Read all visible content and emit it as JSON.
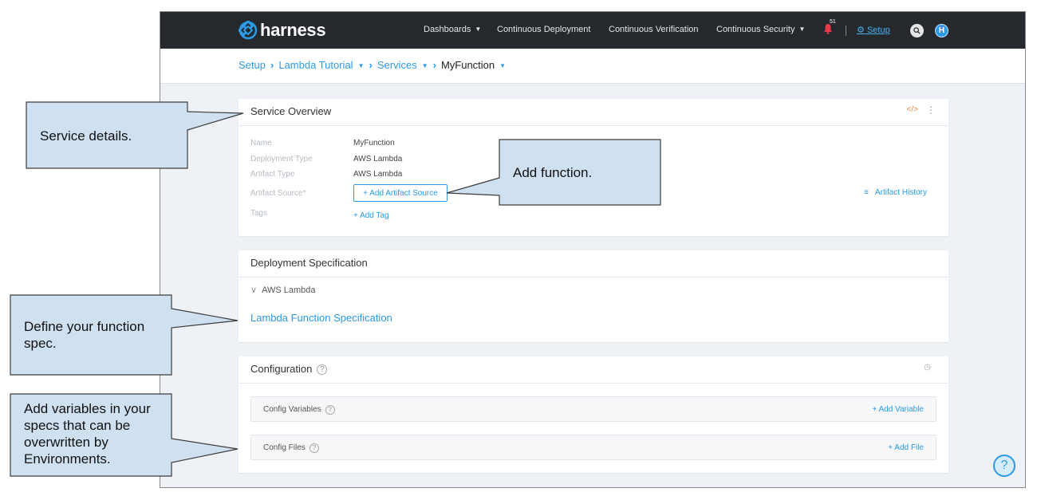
{
  "app": {
    "brand": "harness",
    "nav": [
      {
        "label": "Dashboards",
        "caret": true
      },
      {
        "label": "Continuous Deployment",
        "caret": false
      },
      {
        "label": "Continuous Verification",
        "caret": false
      },
      {
        "label": "Continuous Security",
        "caret": true
      }
    ],
    "notification_count": "51",
    "setup_label": "Setup",
    "avatar_initial": "H",
    "accent_color": "#2b9be6",
    "nav_bg": "#25282c"
  },
  "breadcrumb": {
    "items": [
      "Setup",
      "Lambda Tutorial",
      "Services",
      "MyFunction"
    ]
  },
  "service_overview": {
    "title": "Service Overview",
    "fields": [
      {
        "label": "Name",
        "value": "MyFunction"
      },
      {
        "label": "Deployment Type",
        "value": "AWS Lambda"
      },
      {
        "label": "Artifact Type",
        "value": "AWS Lambda"
      }
    ],
    "artifact_source_label": "Artifact Source*",
    "add_artifact_source": "+ Add Artifact Source",
    "tags_label": "Tags",
    "add_tag": "+ Add Tag",
    "artifact_history": "Artifact History"
  },
  "deployment_spec": {
    "title": "Deployment Specification",
    "section": "AWS Lambda",
    "link": "Lambda Function Specification"
  },
  "configuration": {
    "title": "Configuration",
    "config_variables": "Config Variables",
    "add_variable": "+ Add Variable",
    "config_files": "Config Files",
    "add_file": "+ Add File"
  },
  "callouts": {
    "service_details": "Service details.",
    "add_function": "Add function.",
    "define_spec": "Define your function spec.",
    "add_variables": "Add variables in your specs that can be overwritten by Environments.",
    "fill_color": "#cfe0f1"
  }
}
